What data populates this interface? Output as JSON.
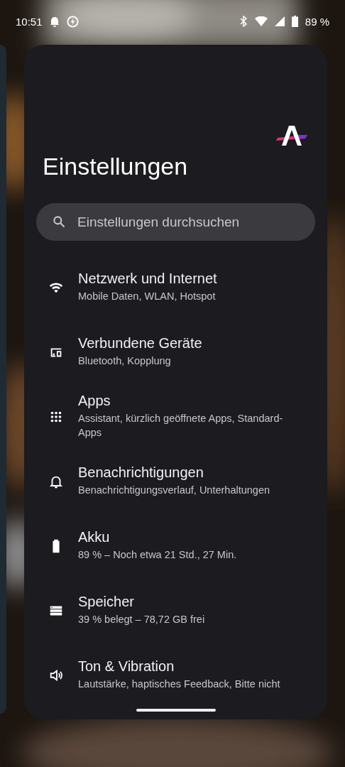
{
  "status_bar": {
    "time": "10:51",
    "battery": "89 %"
  },
  "app": {
    "title": "Einstellungen",
    "search": {
      "placeholder": "Einstellungen durchsuchen"
    },
    "items": [
      {
        "kind": "wifi",
        "title": "Netzwerk und Internet",
        "subtitle": "Mobile Daten, WLAN, Hotspot"
      },
      {
        "kind": "devices",
        "title": "Verbundene Geräte",
        "subtitle": "Bluetooth, Kopplung"
      },
      {
        "kind": "apps",
        "title": "Apps",
        "subtitle": "Assistant, kürzlich geöffnete Apps, Standard-Apps"
      },
      {
        "kind": "bell",
        "title": "Benachrichtigungen",
        "subtitle": "Benachrichtigungsverlauf, Unterhaltungen"
      },
      {
        "kind": "battery",
        "title": "Akku",
        "subtitle": "89 % – Noch etwa 21 Std., 27 Min."
      },
      {
        "kind": "storage",
        "title": "Speicher",
        "subtitle": "39 % belegt – 78,72 GB frei"
      },
      {
        "kind": "sound",
        "title": "Ton & Vibration",
        "subtitle": "Lautstärke, haptisches Feedback, Bitte nicht"
      }
    ]
  }
}
